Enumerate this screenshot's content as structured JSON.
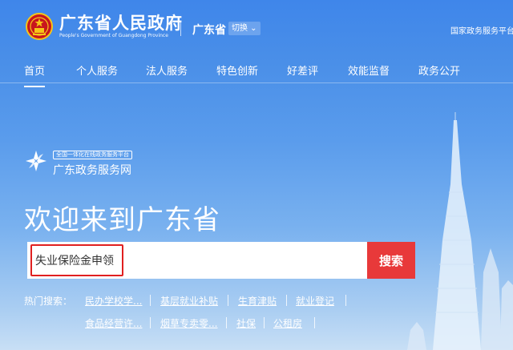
{
  "header": {
    "gov_title": "广东省人民政府",
    "gov_subtitle": "People's Government of Guangdong Province",
    "province": "广东省",
    "switch_label": "切换",
    "national_link": "国家政务服务平台"
  },
  "nav": {
    "items": [
      {
        "label": "首页",
        "active": true
      },
      {
        "label": "个人服务"
      },
      {
        "label": "法人服务"
      },
      {
        "label": "特色创新"
      },
      {
        "label": "好差评"
      },
      {
        "label": "效能监督"
      },
      {
        "label": "政务公开"
      }
    ]
  },
  "portal": {
    "tag": "全国一体化在线政务服务平台",
    "name": "广东政务服务网"
  },
  "hero": {
    "welcome": "欢迎来到广东省"
  },
  "search": {
    "value": "失业保险金申领",
    "button_label": "搜索"
  },
  "hot": {
    "label": "热门搜索：",
    "row1": [
      "民办学校学...",
      "基层就业补贴",
      "生育津贴",
      "就业登记"
    ],
    "row2": [
      "食品经营许...",
      "烟草专卖零...",
      "社保",
      "公租房"
    ]
  },
  "colors": {
    "accent_red": "#e8393a",
    "highlight_red": "#e02020",
    "background_blue": "#4a8fe8"
  }
}
